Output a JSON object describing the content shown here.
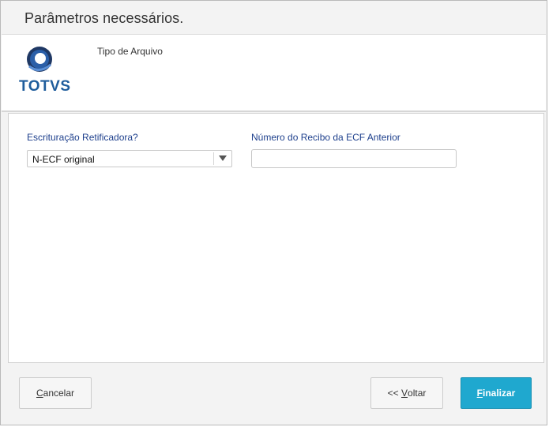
{
  "window": {
    "title": "Parâmetros necessários."
  },
  "header": {
    "logo_text": "TOTVS",
    "label": "Tipo de Arquivo"
  },
  "form": {
    "retificadora": {
      "label": "Escrituração Retificadora?",
      "value": "N-ECF original"
    },
    "recibo": {
      "label": "Número do Recibo da ECF Anterior",
      "value": "",
      "placeholder": ""
    }
  },
  "footer": {
    "cancel_label": "Cancelar",
    "back_prefix": "<< ",
    "back_mnemonic": "V",
    "back_rest": "oltar",
    "finish_mnemonic": "F",
    "finish_rest": "inalizar"
  },
  "colors": {
    "brand": "#1f5d9c",
    "label_blue": "#1d3f8c",
    "primary_button": "#1fa8cf"
  }
}
